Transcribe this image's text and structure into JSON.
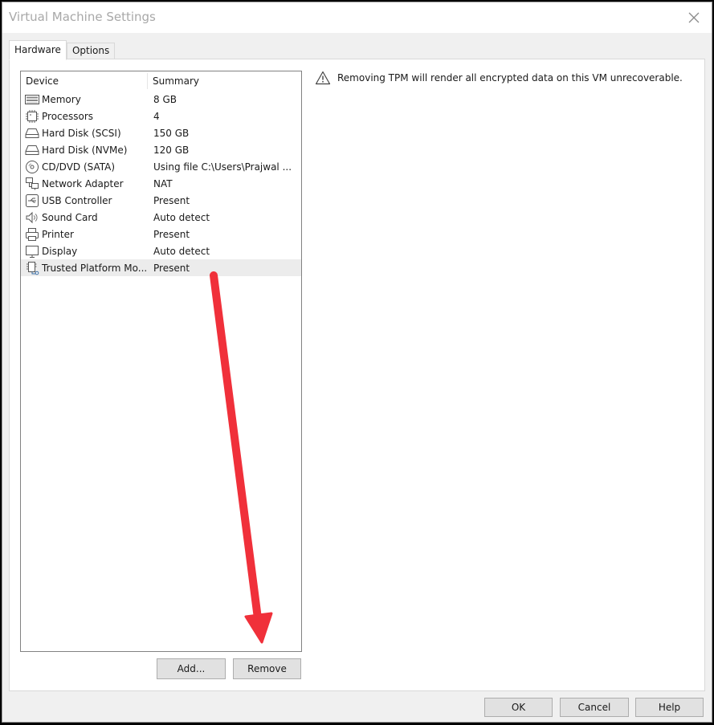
{
  "window": {
    "title": "Virtual Machine Settings",
    "close_icon": "close-icon"
  },
  "tabs": [
    {
      "label": "Hardware",
      "active": true
    },
    {
      "label": "Options",
      "active": false
    }
  ],
  "device_list": {
    "headers": {
      "device": "Device",
      "summary": "Summary"
    },
    "rows": [
      {
        "icon": "memory-icon",
        "device": "Memory",
        "summary": "8 GB"
      },
      {
        "icon": "processor-icon",
        "device": "Processors",
        "summary": "4"
      },
      {
        "icon": "hard-disk-icon",
        "device": "Hard Disk (SCSI)",
        "summary": "150 GB"
      },
      {
        "icon": "hard-disk-icon",
        "device": "Hard Disk (NVMe)",
        "summary": "120 GB"
      },
      {
        "icon": "cd-dvd-icon",
        "device": "CD/DVD (SATA)",
        "summary": "Using file C:\\Users\\Prajwal ..."
      },
      {
        "icon": "network-adapter-icon",
        "device": "Network Adapter",
        "summary": "NAT"
      },
      {
        "icon": "usb-icon",
        "device": "USB Controller",
        "summary": "Present"
      },
      {
        "icon": "sound-card-icon",
        "device": "Sound Card",
        "summary": "Auto detect"
      },
      {
        "icon": "printer-icon",
        "device": "Printer",
        "summary": "Present"
      },
      {
        "icon": "display-icon",
        "device": "Display",
        "summary": "Auto detect"
      },
      {
        "icon": "tpm-icon",
        "device": "Trusted Platform Mo...",
        "summary": "Present",
        "selected": true
      }
    ]
  },
  "buttons": {
    "add": "Add...",
    "remove": "Remove",
    "ok": "OK",
    "cancel": "Cancel",
    "help": "Help"
  },
  "warning": {
    "icon": "warning-icon",
    "text": "Removing TPM will render all encrypted data on this VM unrecoverable."
  },
  "annotation": {
    "type": "arrow",
    "color": "#f0303a",
    "points_to": "Remove"
  }
}
